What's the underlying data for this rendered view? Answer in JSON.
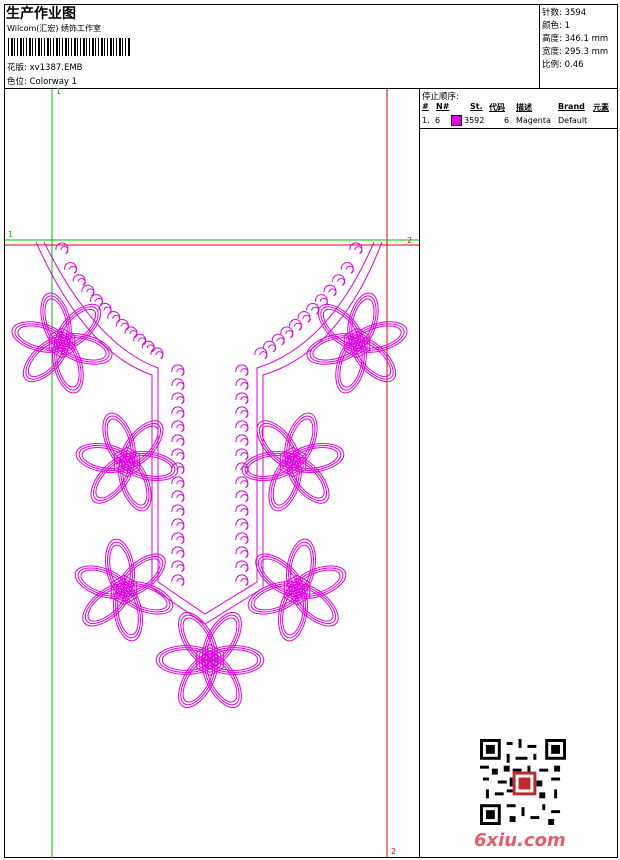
{
  "header": {
    "title": "生产作业图",
    "subtitle": "Wilcom(汇宏) 绣饰工作室",
    "design_label": "花版:",
    "design_file": "xv1387.EMB",
    "colorway_label": "色位:",
    "colorway": "Colorway 1"
  },
  "stats": {
    "stitches_label": "针数:",
    "stitches": "3594",
    "colors_label": "颜色:",
    "colors": "1",
    "height_label": "高度:",
    "height": "346.1 mm",
    "width_label": "宽度:",
    "width": "295.3 mm",
    "scale_label": "比例:",
    "scale": "0.46"
  },
  "stop_sequence": {
    "title": "停止顺序:",
    "headers": [
      "#",
      "N#",
      "St.",
      "代码",
      "描述",
      "Brand",
      "元素"
    ],
    "rows": [
      {
        "num": "1.",
        "needle": "6",
        "stitches": "3592",
        "code": "6",
        "desc": "Magenta",
        "brand": "Default",
        "color": "#e000e0"
      }
    ]
  },
  "guides": {
    "h1": "1",
    "h2": "2",
    "v1": "1",
    "v2": "2"
  },
  "watermark": "6xiu.com",
  "colors": {
    "thread": "#e000e0",
    "guide_green": "#00c000",
    "guide_red": "#e00000"
  }
}
